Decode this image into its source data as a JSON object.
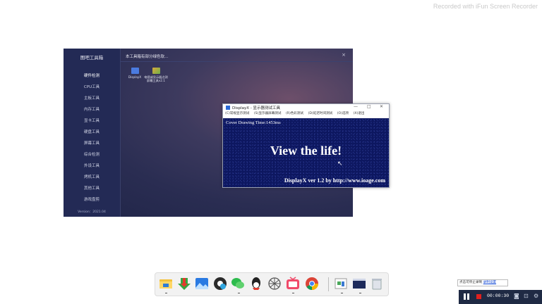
{
  "watermark": "Recorded with iFun Screen Recorder",
  "toolbox": {
    "title": "图吧工具箱",
    "header": "本工具箱有部分绿色软...",
    "close": "×",
    "nav": [
      "硬件检测",
      "CPU工具",
      "主板工具",
      "内存工具",
      "显卡工具",
      "硬盘工具",
      "屏幕工具",
      "综合检测",
      "外设工具",
      "烤机工具",
      "其他工具",
      "游戏盘剪"
    ],
    "version": "Version：2021.04",
    "apps": [
      {
        "label": "DisplayX",
        "color": "#4b7be0"
      },
      {
        "label": "电视或显示器点测屏幕工具v2.1",
        "color": "#d9a93b"
      }
    ]
  },
  "displayx": {
    "title": "DisplayX - 显示器测试工具",
    "controls": {
      "min": "—",
      "max": "□",
      "close": "✕"
    },
    "menu": [
      "(C)常规显示测试",
      "(S)显示器屏幕测试",
      "(R)色彩测试",
      "(D)延迟时间测试",
      "(O)选项",
      "(X)退出"
    ],
    "cover_text": "Cover Drawing Time:1453ms",
    "big_text": "View the life!",
    "footer": "DisplayX ver 1.2 by http://www.ioage.com"
  },
  "taskbar": {
    "icons": [
      "file-explorer-icon",
      "download-icon",
      "photos-icon",
      "media-player-icon",
      "wechat-icon",
      "qq-icon",
      "network-icon",
      "tv-icon",
      "chrome-icon",
      "screenshot-tool-icon",
      "terminal-icon",
      "recycle-bin-icon"
    ]
  },
  "recorder": {
    "tooltip_text": "点击可停止录制",
    "tooltip_link": "录制设置",
    "time": "00:00:30"
  }
}
